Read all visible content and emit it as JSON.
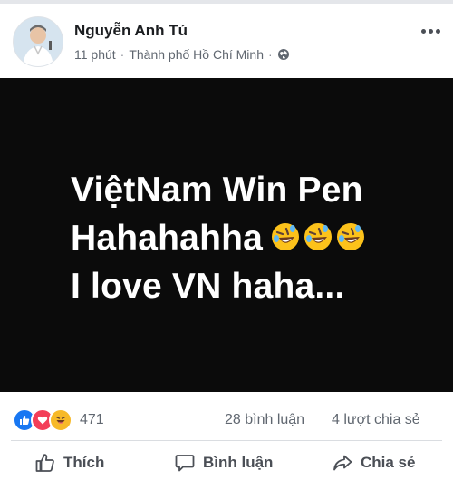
{
  "header": {
    "author": "Nguyễn Anh Tú",
    "time": "11 phút",
    "separator": "·",
    "location": "Thành phố Hồ Chí Minh",
    "separator2": "·",
    "privacy_icon": "globe-icon",
    "more_icon": "more-dots-icon"
  },
  "post": {
    "line1": "ViệtNam Win Pen",
    "line2": "Hahahahha",
    "line2_emoji": [
      "rolling-on-floor-laughing",
      "rolling-on-floor-laughing",
      "rolling-on-floor-laughing"
    ],
    "line3": "I love VN haha...",
    "background": "#0b0b0b",
    "text_color": "#ffffff"
  },
  "stats": {
    "reactions": [
      "like",
      "love",
      "haha"
    ],
    "reaction_count": "471",
    "comments": "28 bình luận",
    "shares": "4 lượt chia sẻ"
  },
  "actions": {
    "like_label": "Thích",
    "comment_label": "Bình luận",
    "share_label": "Chia sẻ"
  },
  "colors": {
    "like_blue": "#1877f2",
    "love_red": "#f33e58",
    "haha_yellow": "#f7b928",
    "secondary_text": "#606770"
  }
}
